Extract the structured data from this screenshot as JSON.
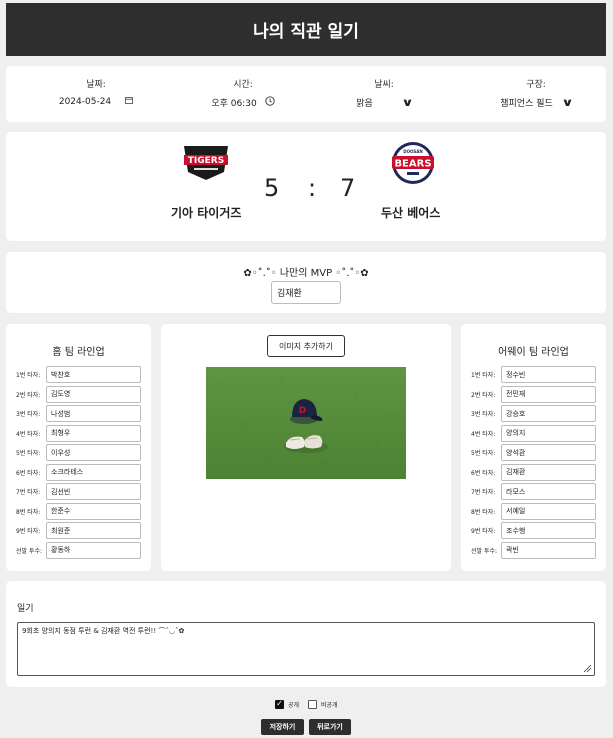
{
  "header": {
    "title": "나의 직관 일기"
  },
  "info": {
    "date_label": "날짜:",
    "date_value": "2024-05-24",
    "date_icon": "calendar-icon",
    "time_label": "시간:",
    "time_value": "오후 06:30",
    "time_icon": "clock-icon",
    "weather_label": "날씨:",
    "weather_value": "맑음",
    "stadium_label": "구장:",
    "stadium_value": "챔피언스 필드"
  },
  "score": {
    "home": {
      "name": "기아 타이거즈",
      "logo_text": "TIGERS",
      "score": "5",
      "color": "#c8102e"
    },
    "away": {
      "name": "두산 베어스",
      "logo_text": "BEARS",
      "logo_sub": "DOOSAN",
      "score": "7",
      "color": "#1d2a5a"
    },
    "separator": ":"
  },
  "mvp": {
    "title": "✿◦˚.˚◦ 나만의 MVP ◦˚.˚◦✿",
    "value": "김재환"
  },
  "home_lineup": {
    "title": "홈 팀 라인업",
    "rows": [
      {
        "label": "1번 타자:",
        "value": "박찬호"
      },
      {
        "label": "2번 타자:",
        "value": "김도영"
      },
      {
        "label": "3번 타자:",
        "value": "나성범"
      },
      {
        "label": "4번 타자:",
        "value": "최형우"
      },
      {
        "label": "5번 타자:",
        "value": "이우성"
      },
      {
        "label": "6번 타자:",
        "value": "소크라테스"
      },
      {
        "label": "7번 타자:",
        "value": "김선빈"
      },
      {
        "label": "8번 타자:",
        "value": "한준수"
      },
      {
        "label": "9번 타자:",
        "value": "최원준"
      },
      {
        "label": "선발 투수:",
        "value": "황동하"
      }
    ]
  },
  "away_lineup": {
    "title": "어웨이 팀 라인업",
    "rows": [
      {
        "label": "1번 타자:",
        "value": "정수빈"
      },
      {
        "label": "2번 타자:",
        "value": "전민재"
      },
      {
        "label": "3번 타자:",
        "value": "강승호"
      },
      {
        "label": "4번 타자:",
        "value": "양의지"
      },
      {
        "label": "5번 타자:",
        "value": "양석환"
      },
      {
        "label": "6번 타자:",
        "value": "김재환"
      },
      {
        "label": "7번 타자:",
        "value": "라모스"
      },
      {
        "label": "8번 타자:",
        "value": "서예일"
      },
      {
        "label": "9번 타자:",
        "value": "조수행"
      },
      {
        "label": "선발 투수:",
        "value": "곽빈"
      }
    ]
  },
  "image_panel": {
    "add_button": "이미지 추가하기",
    "photo_subject": "baseball-cap-and-shoes-on-grass"
  },
  "diary": {
    "label": "일기",
    "text": "9회초 양의지 동점 투런 & 김재환 역전 투런!! ⌒ˆ◡ˆ✿"
  },
  "visibility": {
    "public_label": "공개",
    "public_checked": true,
    "private_label": "비공개",
    "private_checked": false
  },
  "actions": {
    "save": "저장하기",
    "back": "뒤로가기"
  }
}
